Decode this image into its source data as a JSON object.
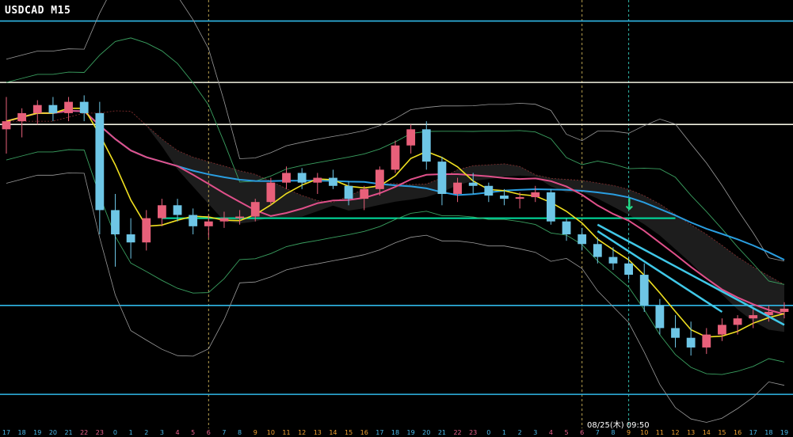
{
  "header": {
    "title": "USDCAD M15"
  },
  "time_marker": {
    "label": "08/25(木) 09:50"
  },
  "signal": {
    "arrow": "↓",
    "color": "#22dd88"
  },
  "colors": {
    "background": "#000000",
    "candle_up": "#e8607a",
    "candle_down": "#6ec6e6",
    "ma_fast": "#f0e020",
    "ma_mid": "#e0508a",
    "ma_slow": "#2a9ee0",
    "bollinger": "#3aa060",
    "envelope": "#9a9a9a",
    "cloud": "#2a2a2a",
    "support": "#00e0a0",
    "trendline": "#40c8e8",
    "level_white": "#f0f0e0",
    "level_cyan": "#30b8e8",
    "session_line": "#b8a050",
    "marker_line": "#30b8a8"
  },
  "chart_data": {
    "type": "candlestick",
    "title": "USDCAD M15",
    "x_tick_labels": [
      "17",
      "18",
      "19",
      "20",
      "21",
      "22",
      "23",
      "0",
      "1",
      "2",
      "3",
      "4",
      "5",
      "6",
      "7",
      "8",
      "9",
      "10",
      "11",
      "12",
      "13",
      "14",
      "15",
      "16",
      "17",
      "18",
      "19",
      "20",
      "21",
      "22",
      "23",
      "0",
      "1",
      "2",
      "3",
      "4",
      "5",
      "6",
      "7",
      "8",
      "9",
      "10",
      "11",
      "12",
      "13",
      "14",
      "15",
      "16",
      "17",
      "18",
      "19"
    ],
    "x_tick_colors": [
      "#4ab8e8",
      "#4ab8e8",
      "#4ab8e8",
      "#4ab8e8",
      "#4ab8e8",
      "#e8608a",
      "#e8608a",
      "#4ab8e8",
      "#4ab8e8",
      "#4ab8e8",
      "#4ab8e8",
      "#e8608a",
      "#e8608a",
      "#e8608a",
      "#4ab8e8",
      "#4ab8e8",
      "#f0a030",
      "#f0a030",
      "#f0a030",
      "#f0a030",
      "#f0a030",
      "#f0a030",
      "#f0a030",
      "#f0a030",
      "#4ab8e8",
      "#4ab8e8",
      "#4ab8e8",
      "#4ab8e8",
      "#4ab8e8",
      "#e8608a",
      "#e8608a",
      "#4ab8e8",
      "#4ab8e8",
      "#4ab8e8",
      "#4ab8e8",
      "#e8608a",
      "#e8608a",
      "#e8608a",
      "#4ab8e8",
      "#4ab8e8",
      "#f0a030",
      "#f0a030",
      "#f0a030",
      "#f0a030",
      "#f0a030",
      "#f0a030",
      "#f0a030",
      "#f0a030",
      "#4ab8e8",
      "#4ab8e8",
      "#4ab8e8"
    ],
    "time_marker_index": 40,
    "horizontal_levels": [
      {
        "name": "resistance-cyan-top",
        "value": 1.0212,
        "color": "#30b8e8"
      },
      {
        "name": "level-white-1",
        "value": 1.0174,
        "color": "#f0f0e0"
      },
      {
        "name": "level-white-2",
        "value": 1.0148,
        "color": "#f0f0e0"
      },
      {
        "name": "level-cyan-low",
        "value": 1.0036,
        "color": "#30b8e8"
      },
      {
        "name": "support-cyan-bottom",
        "value": 0.9981,
        "color": "#30b8e8"
      }
    ],
    "support_line": {
      "value": 1.009,
      "from_index": 10,
      "to_index": 43
    },
    "trendlines": [
      {
        "from": [
          38,
          1.0086
        ],
        "to": [
          50,
          1.0024
        ]
      },
      {
        "from": [
          38,
          1.0082
        ],
        "to": [
          46,
          1.0032
        ]
      }
    ],
    "candles": [
      [
        1.0145,
        1.0165,
        1.013,
        1.015
      ],
      [
        1.015,
        1.0158,
        1.014,
        1.0155
      ],
      [
        1.0155,
        1.0163,
        1.0148,
        1.016
      ],
      [
        1.016,
        1.0165,
        1.015,
        1.0155
      ],
      [
        1.0155,
        1.0165,
        1.015,
        1.0162
      ],
      [
        1.0162,
        1.0166,
        1.015,
        1.0155
      ],
      [
        1.0155,
        1.0162,
        1.008,
        1.0095
      ],
      [
        1.0095,
        1.0105,
        1.006,
        1.008
      ],
      [
        1.008,
        1.009,
        1.0065,
        1.0075
      ],
      [
        1.0075,
        1.0095,
        1.007,
        1.009
      ],
      [
        1.009,
        1.0102,
        1.0085,
        1.0098
      ],
      [
        1.0098,
        1.0102,
        1.0088,
        1.0092
      ],
      [
        1.0092,
        1.0096,
        1.008,
        1.0085
      ],
      [
        1.0085,
        1.0092,
        1.0078,
        1.0088
      ],
      [
        1.0088,
        1.0094,
        1.0084,
        1.009
      ],
      [
        1.009,
        1.0095,
        1.0086,
        1.0091
      ],
      [
        1.0091,
        1.0102,
        1.0088,
        1.01
      ],
      [
        1.01,
        1.0115,
        1.0098,
        1.0112
      ],
      [
        1.0112,
        1.0122,
        1.0108,
        1.0118
      ],
      [
        1.0118,
        1.0121,
        1.0108,
        1.0112
      ],
      [
        1.0112,
        1.0118,
        1.0105,
        1.0115
      ],
      [
        1.0115,
        1.012,
        1.0108,
        1.011
      ],
      [
        1.011,
        1.0113,
        1.0098,
        1.0102
      ],
      [
        1.0102,
        1.011,
        1.0095,
        1.0108
      ],
      [
        1.0108,
        1.0122,
        1.0104,
        1.012
      ],
      [
        1.012,
        1.0138,
        1.0118,
        1.0135
      ],
      [
        1.0135,
        1.0148,
        1.013,
        1.0145
      ],
      [
        1.0145,
        1.015,
        1.012,
        1.0125
      ],
      [
        1.0125,
        1.0128,
        1.0098,
        1.0105
      ],
      [
        1.0105,
        1.0115,
        1.01,
        1.0112
      ],
      [
        1.0112,
        1.0118,
        1.0105,
        1.011
      ],
      [
        1.011,
        1.0112,
        1.01,
        1.0104
      ],
      [
        1.0104,
        1.0108,
        1.0098,
        1.0102
      ],
      [
        1.0102,
        1.0106,
        1.0096,
        1.0103
      ],
      [
        1.0103,
        1.011,
        1.01,
        1.0106
      ],
      [
        1.0106,
        1.0108,
        1.0086,
        1.0088
      ],
      [
        1.0088,
        1.009,
        1.0076,
        1.008
      ],
      [
        1.008,
        1.0084,
        1.007,
        1.0074
      ],
      [
        1.0074,
        1.0078,
        1.0062,
        1.0066
      ],
      [
        1.0066,
        1.0072,
        1.0058,
        1.0062
      ],
      [
        1.0062,
        1.0066,
        1.0052,
        1.0055
      ],
      [
        1.0055,
        1.0062,
        1.0032,
        1.0036
      ],
      [
        1.0036,
        1.004,
        1.0018,
        1.0022
      ],
      [
        1.0022,
        1.003,
        1.001,
        1.0016
      ],
      [
        1.0016,
        1.0026,
        1.0005,
        1.001
      ],
      [
        1.001,
        1.0022,
        1.0006,
        1.0018
      ],
      [
        1.0018,
        1.0028,
        1.0014,
        1.0024
      ],
      [
        1.0024,
        1.003,
        1.0018,
        1.0028
      ],
      [
        1.0028,
        1.0034,
        1.0022,
        1.003
      ],
      [
        1.003,
        1.0036,
        1.0026,
        1.0032
      ],
      [
        1.0032,
        1.0038,
        1.0028,
        1.0034
      ]
    ]
  }
}
